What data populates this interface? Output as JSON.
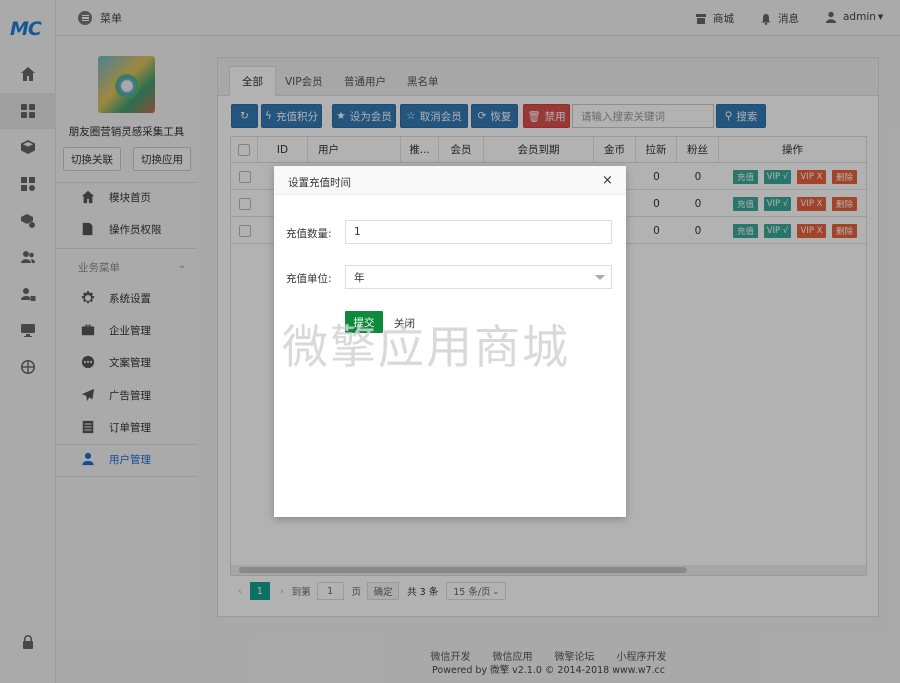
{
  "brand": {
    "logo_text": "MC"
  },
  "rail": {
    "items": [
      {
        "icon": "home-icon"
      },
      {
        "icon": "grid-icon"
      },
      {
        "icon": "cube-icon"
      },
      {
        "icon": "apps-settings-icon"
      },
      {
        "icon": "box-settings-icon"
      },
      {
        "icon": "users-icon"
      },
      {
        "icon": "user-lock-icon"
      },
      {
        "icon": "monitor-icon"
      },
      {
        "icon": "globe-icon"
      }
    ],
    "bottom_icon": "lock-icon"
  },
  "topbar": {
    "menu_label": "菜单",
    "store_label": "商城",
    "message_label": "消息",
    "user_label": "admin"
  },
  "app": {
    "name": "朋友圈营销灵感采集工具",
    "switch_relation": "切换关联",
    "switch_app": "切换应用"
  },
  "sidebar": {
    "top_items": [
      {
        "label": "模块首页",
        "icon": "home-icon"
      },
      {
        "label": "操作员权限",
        "icon": "edit-icon"
      }
    ],
    "section_title": "业务菜单",
    "items": [
      {
        "label": "系统设置",
        "icon": "gear-icon"
      },
      {
        "label": "企业管理",
        "icon": "briefcase-icon"
      },
      {
        "label": "文案管理",
        "icon": "dots-icon"
      },
      {
        "label": "广告管理",
        "icon": "send-icon"
      },
      {
        "label": "订单管理",
        "icon": "list-icon"
      },
      {
        "label": "用户管理",
        "icon": "user-icon",
        "active": true
      }
    ]
  },
  "tabs": [
    "全部",
    "VIP会员",
    "普通用户",
    "黑名单"
  ],
  "toolbar": {
    "refresh_label": "",
    "recharge_label": "充值积分",
    "set_member_label": "设为会员",
    "cancel_member_label": "取消会员",
    "restore_label": "恢复",
    "ban_label": "禁用",
    "search_placeholder": "请输入搜索关键词",
    "search_label": "搜索"
  },
  "table": {
    "columns": [
      "ID",
      "用户",
      "推...",
      "会员",
      "会员到期",
      "金币",
      "拉新",
      "粉丝",
      "操作"
    ],
    "rows": [
      {
        "coins": "",
        "invites": "0",
        "fans": "0"
      },
      {
        "coins": "",
        "invites": "0",
        "fans": "0"
      },
      {
        "coins": "",
        "invites": "0",
        "fans": "0"
      }
    ],
    "actions": [
      "充值",
      "VIP √",
      "VIP X",
      "删除"
    ]
  },
  "pager": {
    "current": "1",
    "goto_label": "到第",
    "page_input": "1",
    "page_unit": "页",
    "confirm": "确定",
    "total": "共 3 条",
    "page_size": "15 条/页"
  },
  "modal": {
    "title": "设置充值时间",
    "close": "×",
    "amount_label": "充值数量:",
    "amount_value": "1",
    "unit_label": "充值单位:",
    "unit_value": "年",
    "submit": "提交",
    "cancel": "关闭"
  },
  "watermark": "微擎应用商城",
  "footer": {
    "links": [
      "微信开发",
      "微信应用",
      "微擎论坛",
      "小程序开发"
    ],
    "copyright": "Powered by 微擎 v2.1.0 © 2014-2018 www.w7.cc"
  }
}
